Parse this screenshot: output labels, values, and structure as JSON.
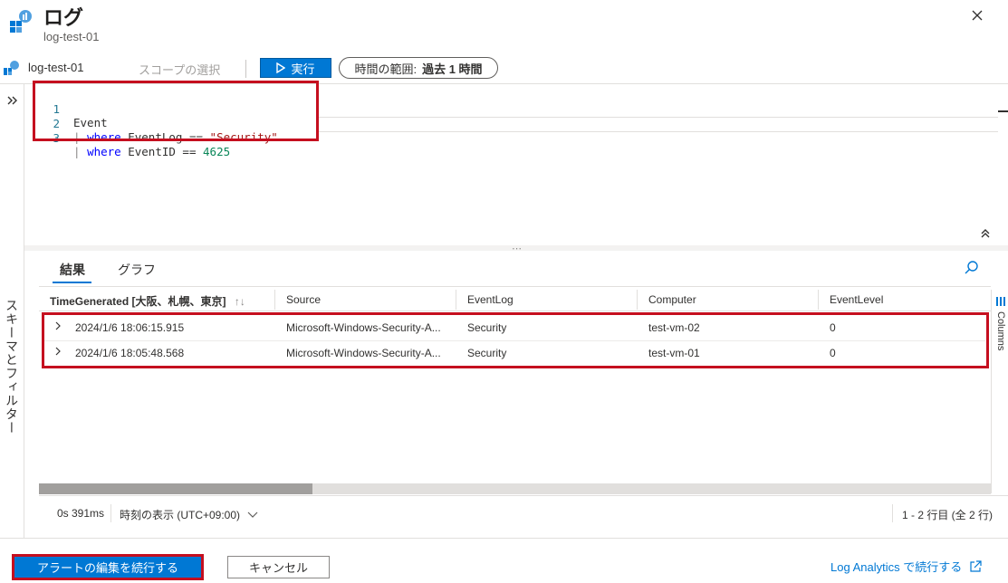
{
  "header": {
    "title": "ログ",
    "subtitle": "log-test-01",
    "icons": {
      "app": "log-analytics-icon",
      "close": "close-icon"
    }
  },
  "toolbar": {
    "scope_name": "log-test-01",
    "scope_select": "スコープの選択",
    "run_label": "実行",
    "time_range_label": "時間の範囲:",
    "time_range_value": "過去 1 時間"
  },
  "sidebar": {
    "label": "スキーマとフィルター"
  },
  "editor": {
    "lines": [
      {
        "num": "1",
        "text": "Event"
      },
      {
        "num": "2",
        "pipe": "| ",
        "keyword": "where",
        "field": " EventLog == ",
        "value": "\"Security\""
      },
      {
        "num": "3",
        "pipe": "| ",
        "keyword": "where",
        "field": " EventID == ",
        "value": "4625"
      }
    ]
  },
  "results": {
    "tabs": [
      {
        "label": "結果",
        "active": true
      },
      {
        "label": "グラフ",
        "active": false
      }
    ],
    "columns": [
      "TimeGenerated [大阪、札幌、東京]",
      "Source",
      "EventLog",
      "Computer",
      "EventLevel"
    ],
    "sort_indicator": "↑↓",
    "rows": [
      [
        "2024/1/6 18:06:15.915",
        "Microsoft-Windows-Security-A...",
        "Security",
        "test-vm-02",
        "0"
      ],
      [
        "2024/1/6 18:05:48.568",
        "Microsoft-Windows-Security-A...",
        "Security",
        "test-vm-01",
        "0"
      ]
    ],
    "columns_panel_label": "Columns"
  },
  "status": {
    "duration": "0s 391ms",
    "timezone": "時刻の表示 (UTC+09:00)",
    "row_count": "1 - 2 行目 (全 2 行)"
  },
  "footer": {
    "continue_label": "アラートの編集を続行する",
    "cancel_label": "キャンセル",
    "link_label": "Log Analytics で続行する"
  },
  "colors": {
    "accent": "#0078d4",
    "highlight": "#c50f1f"
  }
}
